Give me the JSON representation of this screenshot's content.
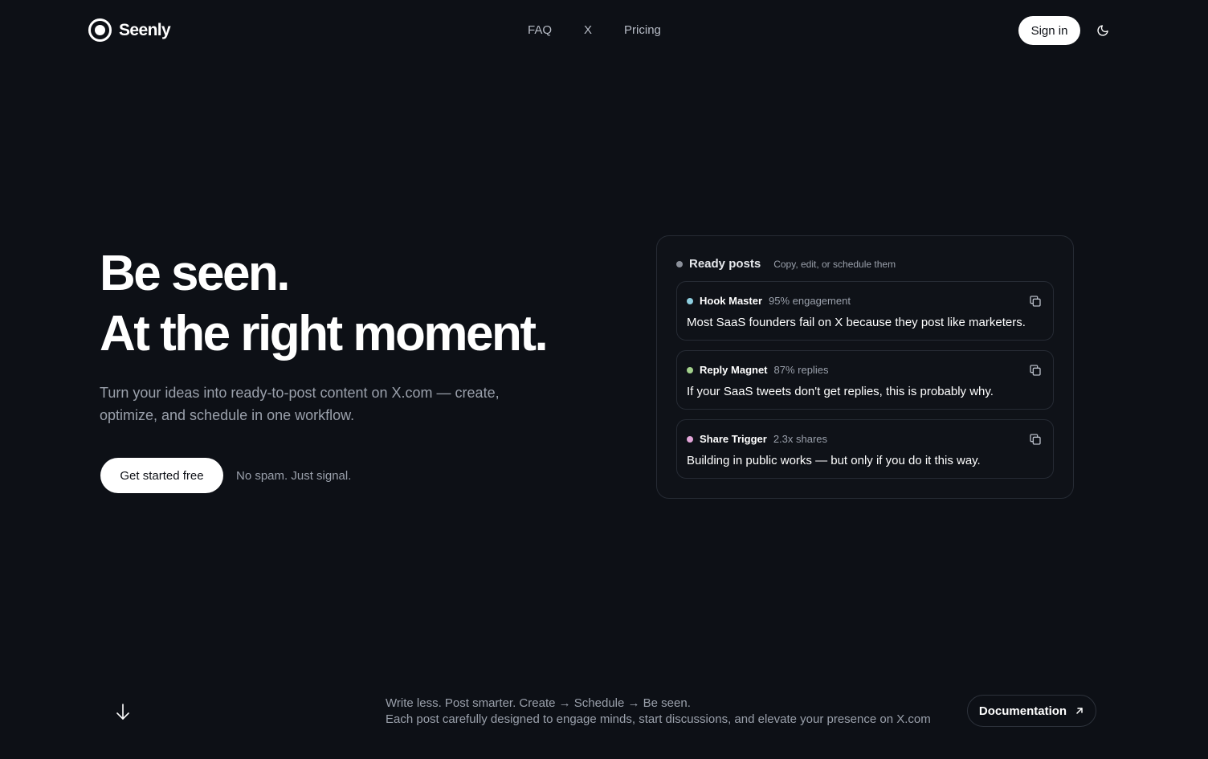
{
  "brand": {
    "name": "Seenly"
  },
  "nav": {
    "links": [
      "FAQ",
      "X",
      "Pricing"
    ],
    "signin_label": "Sign in",
    "theme_icon": "moon-icon"
  },
  "hero": {
    "headline_line1": "Be seen.",
    "headline_line2": "At the right moment.",
    "subtext": "Turn your ideas into ready-to-post content on X.com — create, optimize, and schedule in one workflow.",
    "cta_label": "Get started free",
    "cta_note": "No spam. Just signal."
  },
  "panel": {
    "title": "Ready posts",
    "subtitle": "Copy, edit, or schedule them",
    "posts": [
      {
        "name": "Hook Master",
        "stat": "95% engagement",
        "text": "Most SaaS founders fail on X because they post like marketers.",
        "dot_color": "#8ecfe0"
      },
      {
        "name": "Reply Magnet",
        "stat": "87% replies",
        "text": "If your SaaS tweets don't get replies, this is probably why.",
        "dot_color": "#a3d18c"
      },
      {
        "name": "Share Trigger",
        "stat": "2.3x shares",
        "text": "Building in public works — but only if you do it this way.",
        "dot_color": "#e3a6d9"
      }
    ]
  },
  "footer": {
    "tagline_line1": "Write less. Post smarter. Create → Schedule → Be seen.",
    "tagline_line2": "Each post carefully designed to engage minds, start discussions, and elevate your presence on X.com",
    "docs_label": "Documentation"
  },
  "colors": {
    "background": "#0d1016",
    "muted_text": "#9aa0ab",
    "border": "#262b34"
  }
}
